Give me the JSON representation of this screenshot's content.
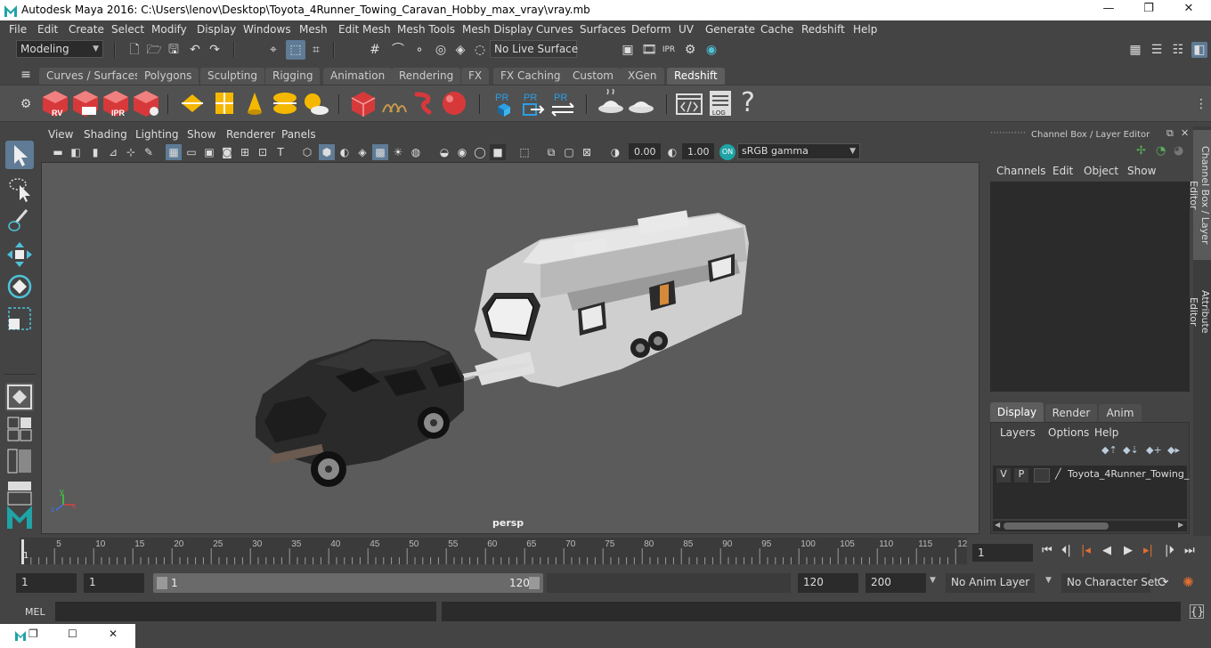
{
  "window": {
    "title": "Autodesk Maya 2016: C:\\Users\\lenov\\Desktop\\Toyota_4Runner_Towing_Caravan_Hobby_max_vray\\vray.mb",
    "minimize": "—",
    "maximize": "❐",
    "close": "✕"
  },
  "menubar": [
    "File",
    "Edit",
    "Create",
    "Select",
    "Modify",
    "Display",
    "Windows",
    "Mesh",
    "Edit Mesh",
    "Mesh Tools",
    "Mesh Display",
    "Curves",
    "Surfaces",
    "Deform",
    "UV",
    "Generate",
    "Cache",
    "Redshift",
    "Help"
  ],
  "statusline": {
    "mode": "Modeling",
    "live_surface": "No Live Surface"
  },
  "shelf_tabs": [
    "Curves / Surfaces",
    "Polygons",
    "Sculpting",
    "Rigging",
    "Animation",
    "Rendering",
    "FX",
    "FX Caching",
    "Custom",
    "XGen",
    "Redshift"
  ],
  "active_shelf": "Redshift",
  "shelf_icons": {
    "rv": "RV",
    "ipr": "IPR",
    "pr1": "PR",
    "pr2": "PR",
    "pr3": "PR",
    "log": "LOG",
    "help": "?"
  },
  "panel_menu": [
    "View",
    "Shading",
    "Lighting",
    "Show",
    "Renderer",
    "Panels"
  ],
  "panel_toolbar": {
    "exposure": "0.00",
    "gamma": "1.00",
    "colorspace": "sRGB gamma"
  },
  "viewport": {
    "camera": "persp",
    "axis_x": "x",
    "axis_y": "y",
    "axis_z": "z"
  },
  "right_panel": {
    "header": "Channel Box / Layer Editor",
    "channel_menu": [
      "Channels",
      "Edit",
      "Object",
      "Show"
    ],
    "layer_tabs": [
      "Display",
      "Render",
      "Anim"
    ],
    "layer_menu": [
      "Layers",
      "Options",
      "Help"
    ],
    "layer": {
      "v": "V",
      "p": "P",
      "name": "Toyota_4Runner_Towing_"
    }
  },
  "side_tabs": [
    "Channel Box / Layer Editor",
    "Attribute Editor"
  ],
  "timeline": {
    "ticks": [
      "5",
      "10",
      "15",
      "20",
      "25",
      "30",
      "35",
      "40",
      "45",
      "50",
      "55",
      "60",
      "65",
      "70",
      "75",
      "80",
      "85",
      "90",
      "95",
      "100",
      "105",
      "110",
      "115",
      "12"
    ],
    "first_frame": "1",
    "current_frame": "1"
  },
  "range": {
    "start": "1",
    "playback_start": "1",
    "slider_start": "1",
    "slider_end": "120",
    "playback_end": "120",
    "end": "200",
    "anim_layer": "No Anim Layer",
    "char_set": "No Character Set"
  },
  "cmdline": {
    "label": "MEL"
  }
}
